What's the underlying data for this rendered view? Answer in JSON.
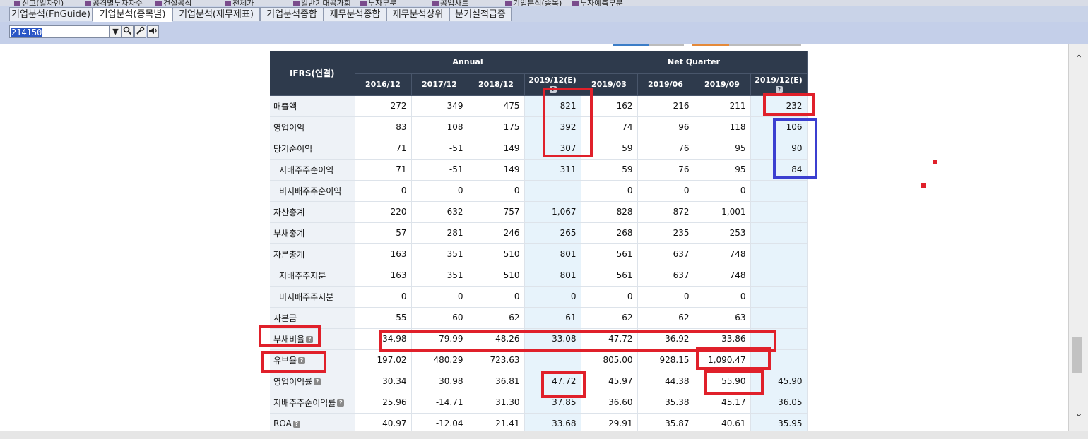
{
  "top_tabs": [
    {
      "label": "신고(일자인)"
    },
    {
      "label": "공격별투자자수"
    },
    {
      "label": "건설공식"
    },
    {
      "label": "전체가"
    },
    {
      "label": "일반기대공가회"
    },
    {
      "label": "투자부분"
    },
    {
      "label": "공업사트"
    },
    {
      "label": "기업분석(종목)"
    },
    {
      "label": "투자예측부분"
    }
  ],
  "tabs": [
    {
      "label": "기업분석(FnGuide)"
    },
    {
      "label": "기업분석(종목별)"
    },
    {
      "label": "기업분석(재무제표)"
    },
    {
      "label": "기업분석종합"
    },
    {
      "label": "재무분석종합"
    },
    {
      "label": "재무분석상위"
    },
    {
      "label": "분기실적급증"
    }
  ],
  "toolbar": {
    "stock_code": "214150",
    "dropdown_icon": "chevron-down-icon",
    "search_icon": "search-icon",
    "tool_icon": "wrench-icon",
    "speaker_icon": "speaker-icon"
  },
  "table": {
    "corner_label": "IFRS(연결)",
    "groups": {
      "annual": "Annual",
      "quarter": "Net Quarter"
    },
    "columns": [
      "2016/12",
      "2017/12",
      "2018/12",
      "2019/12(E)",
      "2019/03",
      "2019/06",
      "2019/09",
      "2019/12(E)"
    ],
    "rows": [
      {
        "label": "매출액",
        "indent": false,
        "help": false,
        "values": [
          "272",
          "349",
          "475",
          "821",
          "162",
          "216",
          "211",
          "232"
        ]
      },
      {
        "label": "영업이익",
        "indent": false,
        "help": false,
        "values": [
          "83",
          "108",
          "175",
          "392",
          "74",
          "96",
          "118",
          "106"
        ]
      },
      {
        "label": "당기순이익",
        "indent": false,
        "help": false,
        "values": [
          "71",
          "-51",
          "149",
          "307",
          "59",
          "76",
          "95",
          "90"
        ]
      },
      {
        "label": "지배주주순이익",
        "indent": true,
        "help": false,
        "values": [
          "71",
          "-51",
          "149",
          "311",
          "59",
          "76",
          "95",
          "84"
        ]
      },
      {
        "label": "비지배주주순이익",
        "indent": true,
        "help": false,
        "values": [
          "0",
          "0",
          "0",
          "",
          "0",
          "0",
          "0",
          ""
        ]
      },
      {
        "label": "자산총계",
        "indent": false,
        "help": false,
        "values": [
          "220",
          "632",
          "757",
          "1,067",
          "828",
          "872",
          "1,001",
          ""
        ]
      },
      {
        "label": "부채총계",
        "indent": false,
        "help": false,
        "values": [
          "57",
          "281",
          "246",
          "265",
          "268",
          "235",
          "253",
          ""
        ]
      },
      {
        "label": "자본총계",
        "indent": false,
        "help": false,
        "values": [
          "163",
          "351",
          "510",
          "801",
          "561",
          "637",
          "748",
          ""
        ]
      },
      {
        "label": "지배주주지분",
        "indent": true,
        "help": false,
        "values": [
          "163",
          "351",
          "510",
          "801",
          "561",
          "637",
          "748",
          ""
        ]
      },
      {
        "label": "비지배주주지분",
        "indent": true,
        "help": false,
        "values": [
          "0",
          "0",
          "0",
          "0",
          "0",
          "0",
          "0",
          ""
        ]
      },
      {
        "label": "자본금",
        "indent": false,
        "help": false,
        "values": [
          "55",
          "60",
          "62",
          "61",
          "62",
          "62",
          "63",
          ""
        ]
      },
      {
        "label": "부채비율",
        "indent": false,
        "help": true,
        "values": [
          "34.98",
          "79.99",
          "48.26",
          "33.08",
          "47.72",
          "36.92",
          "33.86",
          ""
        ]
      },
      {
        "label": "유보율",
        "indent": false,
        "help": true,
        "values": [
          "197.02",
          "480.29",
          "723.63",
          "",
          "805.00",
          "928.15",
          "1,090.47",
          ""
        ]
      },
      {
        "label": "영업이익률",
        "indent": false,
        "help": true,
        "values": [
          "30.34",
          "30.98",
          "36.81",
          "47.72",
          "45.97",
          "44.38",
          "55.90",
          "45.90"
        ]
      },
      {
        "label": "지배주주순이익률",
        "indent": false,
        "help": true,
        "values": [
          "25.96",
          "-14.71",
          "31.30",
          "37.85",
          "36.60",
          "35.38",
          "45.17",
          "36.05"
        ]
      },
      {
        "label": "ROA",
        "indent": false,
        "help": true,
        "values": [
          "40.97",
          "-12.04",
          "21.41",
          "33.68",
          "29.91",
          "35.87",
          "40.61",
          "35.95"
        ]
      }
    ]
  },
  "colors": {
    "header_bg": "#2e3a4c",
    "estimate_bg": "#e7f3fb",
    "negative": "#d3202a",
    "highlight_red": "#e0202a",
    "highlight_blue": "#3b3fd0"
  },
  "help_mark": "?"
}
